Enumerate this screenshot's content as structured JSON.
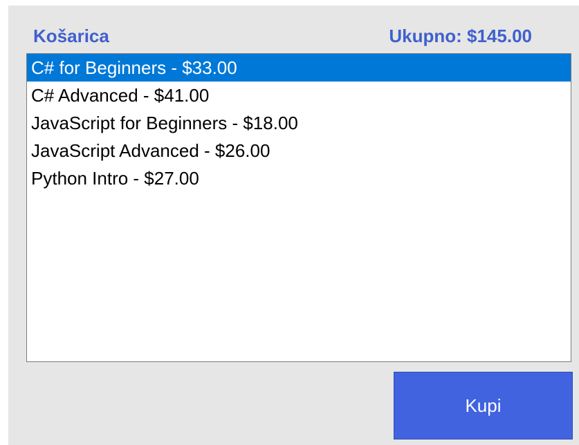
{
  "cart": {
    "title": "Košarica",
    "total_label": "Ukupno: $145.00",
    "items": [
      "C# for Beginners - $33.00",
      "C# Advanced - $41.00",
      "JavaScript for Beginners - $18.00",
      "JavaScript Advanced - $26.00",
      "Python Intro - $27.00"
    ],
    "selected_index": 0,
    "buy_label": "Kupi"
  },
  "colors": {
    "accent": "#4060cc",
    "button": "#4163e0",
    "selection": "#0078d7",
    "background": "#e6e6e6"
  }
}
